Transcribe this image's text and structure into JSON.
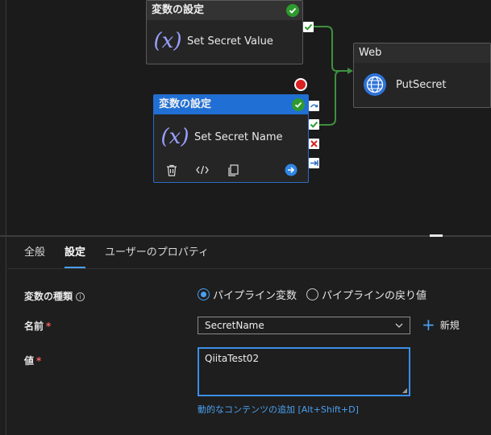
{
  "canvas": {
    "node_set_value": {
      "header": "変数の設定",
      "title": "Set Secret Value",
      "icon": "variable-fx-icon"
    },
    "node_set_name": {
      "header": "変数の設定",
      "title": "Set Secret Name",
      "icon": "variable-fx-icon",
      "actions": [
        "delete-icon",
        "code-icon",
        "copy-icon",
        "arrow-right-circle-icon"
      ]
    },
    "node_web": {
      "header": "Web",
      "title": "PutSecret",
      "icon": "globe-icon"
    },
    "colors": {
      "selected_header": "#1f6fd4",
      "success_badge": "#2e9a2e",
      "connector": "#3f8f3f",
      "fail_port": "#d92222"
    }
  },
  "panel": {
    "tabs": [
      {
        "label": "全般"
      },
      {
        "label": "設定"
      },
      {
        "label": "ユーザーのプロパティ"
      }
    ],
    "variable_type": {
      "label": "変数の種類",
      "options": [
        "パイプライン変数",
        "パイプラインの戻り値"
      ],
      "selected": "パイプライン変数"
    },
    "name": {
      "label": "名前",
      "required_mark": "*",
      "value": "SecretName",
      "new_label": "新規"
    },
    "value": {
      "label": "値",
      "required_mark": "*",
      "text": "QiitaTest02",
      "dynamic_link": "動的なコンテンツの追加 [Alt+Shift+D]"
    }
  }
}
